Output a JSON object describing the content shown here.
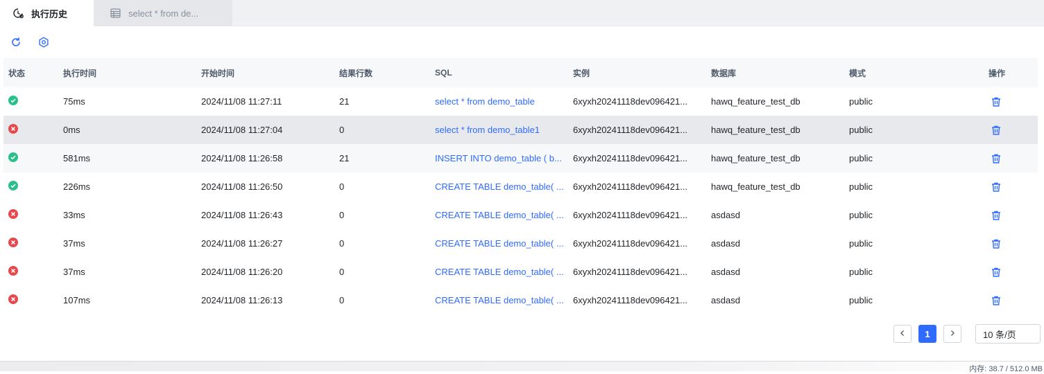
{
  "tabs": [
    {
      "label": "执行历史",
      "icon": "history-clock-icon",
      "active": true
    },
    {
      "label": "select * from de...",
      "icon": "table-grid-icon",
      "active": false
    }
  ],
  "toolbar": {
    "refresh_icon": "refresh-icon",
    "settings_icon": "settings-gear-icon"
  },
  "colors": {
    "accent": "#2f6bff",
    "success": "#2bbf8a",
    "error": "#e5484d"
  },
  "table": {
    "columns": [
      "状态",
      "执行时间",
      "开始时间",
      "结果行数",
      "SQL",
      "实例",
      "数据库",
      "模式",
      "操作"
    ],
    "rows": [
      {
        "status": "success",
        "duration": "75ms",
        "start": "2024/11/08 11:27:11",
        "rows": "21",
        "sql": "select * from demo_table",
        "instance": "6xyxh20241118dev096421...",
        "database": "hawq_feature_test_db",
        "schema": "public"
      },
      {
        "status": "error",
        "duration": "0ms",
        "start": "2024/11/08 11:27:04",
        "rows": "0",
        "sql": "select * from demo_table1",
        "instance": "6xyxh20241118dev096421...",
        "database": "hawq_feature_test_db",
        "schema": "public"
      },
      {
        "status": "success",
        "duration": "581ms",
        "start": "2024/11/08 11:26:58",
        "rows": "21",
        "sql": "INSERT INTO demo_table ( b...",
        "instance": "6xyxh20241118dev096421...",
        "database": "hawq_feature_test_db",
        "schema": "public"
      },
      {
        "status": "success",
        "duration": "226ms",
        "start": "2024/11/08 11:26:50",
        "rows": "0",
        "sql": "CREATE TABLE demo_table( ...",
        "instance": "6xyxh20241118dev096421...",
        "database": "hawq_feature_test_db",
        "schema": "public"
      },
      {
        "status": "error",
        "duration": "33ms",
        "start": "2024/11/08 11:26:43",
        "rows": "0",
        "sql": "CREATE TABLE demo_table( ...",
        "instance": "6xyxh20241118dev096421...",
        "database": "asdasd",
        "schema": "public"
      },
      {
        "status": "error",
        "duration": "37ms",
        "start": "2024/11/08 11:26:27",
        "rows": "0",
        "sql": "CREATE TABLE demo_table( ...",
        "instance": "6xyxh20241118dev096421...",
        "database": "asdasd",
        "schema": "public"
      },
      {
        "status": "error",
        "duration": "37ms",
        "start": "2024/11/08 11:26:20",
        "rows": "0",
        "sql": "CREATE TABLE demo_table( ...",
        "instance": "6xyxh20241118dev096421...",
        "database": "asdasd",
        "schema": "public"
      },
      {
        "status": "error",
        "duration": "107ms",
        "start": "2024/11/08 11:26:13",
        "rows": "0",
        "sql": "CREATE TABLE demo_table( ...",
        "instance": "6xyxh20241118dev096421...",
        "database": "asdasd",
        "schema": "public"
      }
    ]
  },
  "pagination": {
    "current_page": "1",
    "page_size": "10 条/页"
  },
  "statusbar": {
    "memory": "内存: 38.7 / 512.0 MB"
  }
}
